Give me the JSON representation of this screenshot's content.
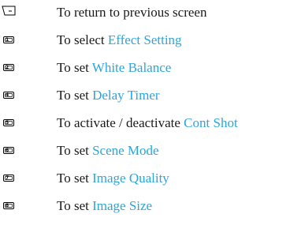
{
  "rows": [
    {
      "icon": "back-key-icon",
      "prefix": "To return to previous screen",
      "highlight": ""
    },
    {
      "icon": "key-1-icon",
      "key": "1",
      "prefix": "To select ",
      "highlight": "Effect Setting"
    },
    {
      "icon": "key-2-icon",
      "key": "2",
      "prefix": "To set ",
      "highlight": "White Balance"
    },
    {
      "icon": "key-4-icon",
      "key": "4",
      "prefix": "To set ",
      "highlight": "Delay Timer"
    },
    {
      "icon": "key-5-icon",
      "key": "5",
      "prefix": "To activate / deactivate ",
      "highlight": "Cont Shot"
    },
    {
      "icon": "key-6-icon",
      "key": "6",
      "prefix": "To set ",
      "highlight": "Scene Mode"
    },
    {
      "icon": "key-7-icon",
      "key": "7",
      "prefix": "To set ",
      "highlight": "Image Quality"
    },
    {
      "icon": "key-8-icon",
      "key": "8",
      "prefix": "To set ",
      "highlight": "Image Size"
    }
  ],
  "colors": {
    "text": "#1a1a1a",
    "highlight": "#29a6de"
  }
}
